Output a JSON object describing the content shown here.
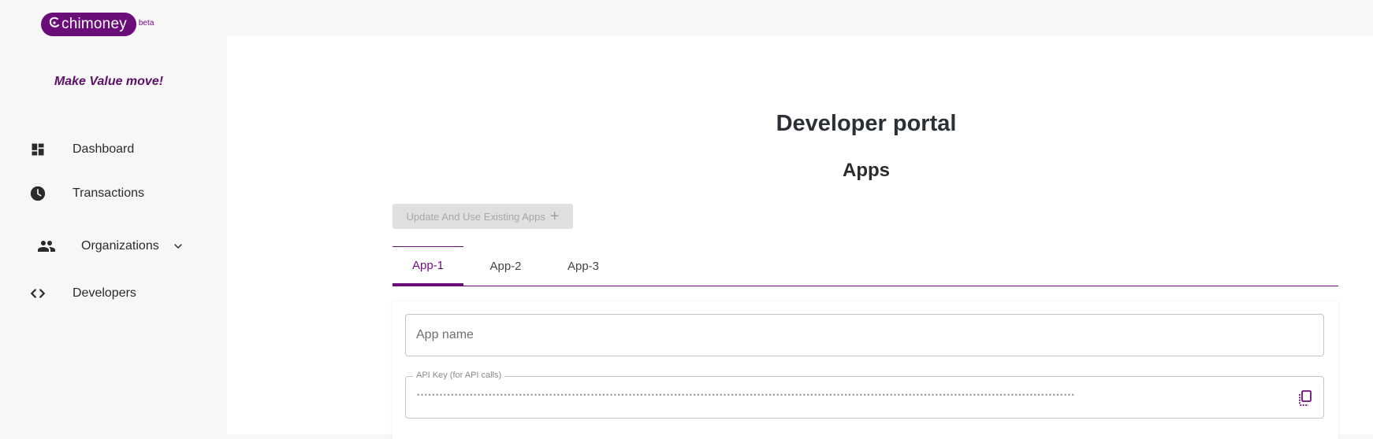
{
  "brand": {
    "name": "chimoney",
    "badge": "beta",
    "tagline": "Make Value move!",
    "color": "#6b0d78"
  },
  "sidebar": {
    "items": [
      {
        "label": "Dashboard",
        "icon": "dashboard-icon"
      },
      {
        "label": "Transactions",
        "icon": "clock-icon"
      },
      {
        "label": "Organizations",
        "icon": "people-icon"
      },
      {
        "label": "Developers",
        "icon": "code-icon"
      }
    ]
  },
  "main": {
    "title": "Developer portal",
    "section_title": "Apps",
    "update_button_label": "Update And Use Existing Apps",
    "tabs": [
      {
        "label": "App-1",
        "active": true
      },
      {
        "label": "App-2",
        "active": false
      },
      {
        "label": "App-3",
        "active": false
      }
    ],
    "form": {
      "app_name_placeholder": "App name",
      "api_key_label": "API Key (for API calls)",
      "api_key_value": "••••••••••••••••••••••••••••••••••••••••••••••••••••••••••••••••••••••••••••••••••••••••••••••••••••••••••••••••••••••••••••••••••••••••••••••••••••••••••••••••••••••••••••••"
    }
  }
}
